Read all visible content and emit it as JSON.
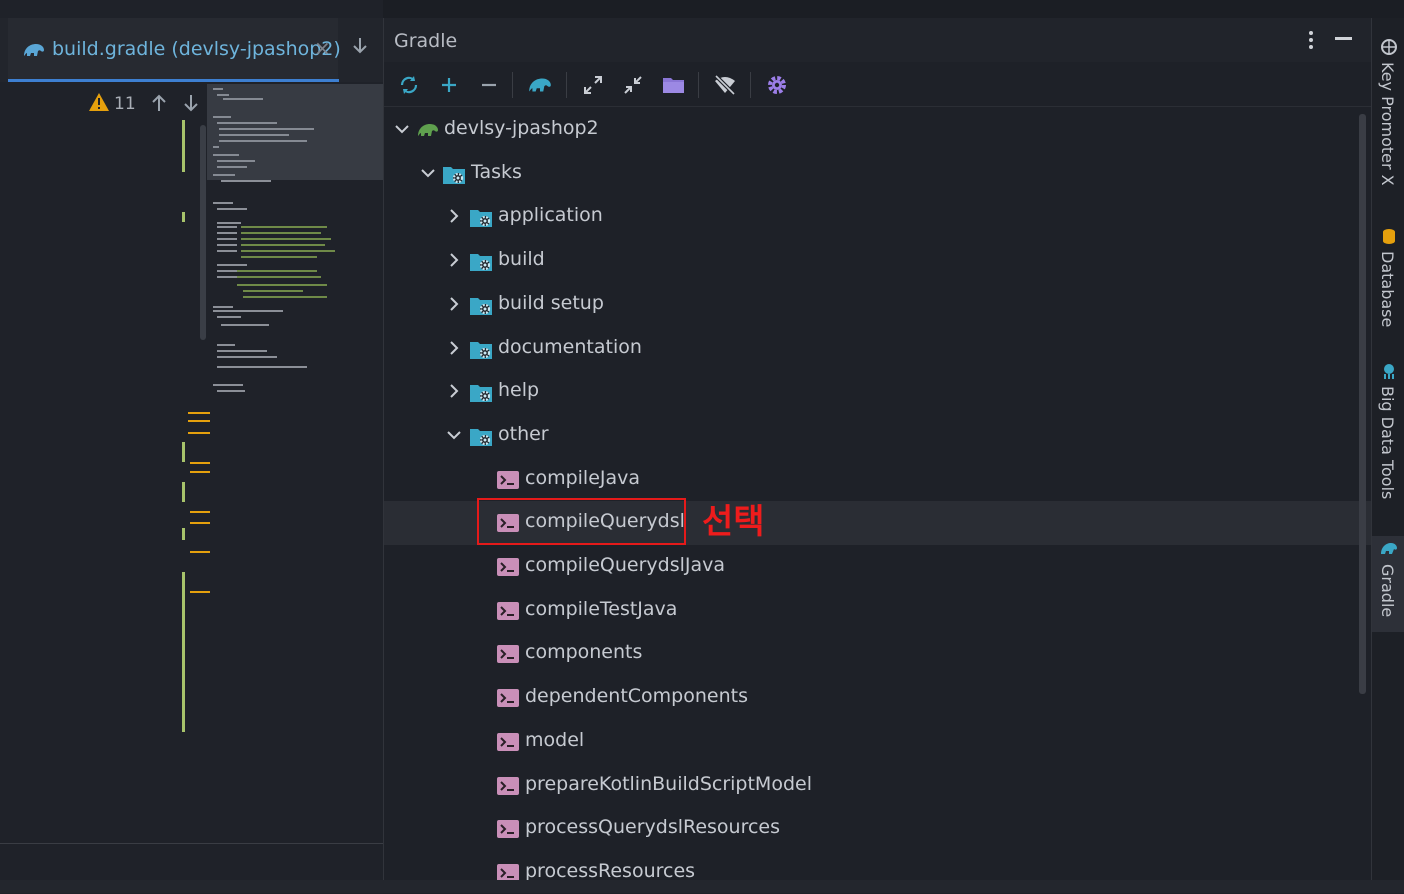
{
  "editor": {
    "tab": {
      "label": "build.gradle (devlsy-jpashop2)",
      "close": "×"
    },
    "inspection": {
      "warning_count": "11"
    }
  },
  "gradle": {
    "title": "Gradle",
    "toolbar": [
      "reload-icon",
      "add-icon",
      "remove-icon",
      "elephant-icon",
      "expand-all-icon",
      "collapse-all-icon",
      "folder-icon",
      "offline-mode-icon",
      "settings-icon"
    ],
    "tree": {
      "project": "devlsy-jpashop2",
      "tasks_label": "Tasks",
      "groups": [
        "application",
        "build",
        "build setup",
        "documentation",
        "help",
        "other"
      ],
      "other_tasks": [
        "compileJava",
        "compileQuerydsl",
        "compileQuerydslJava",
        "compileTestJava",
        "components",
        "dependentComponents",
        "model",
        "prepareKotlinBuildScriptModel",
        "processQuerydslResources",
        "processResources"
      ],
      "selected_task": "compileQuerydsl"
    },
    "annotation": "선택"
  },
  "stripe": {
    "items": [
      "Key Promoter X",
      "Database",
      "Big Data Tools",
      "Gradle"
    ],
    "active": "Gradle"
  },
  "colors": {
    "accent": "#3d7fd1",
    "annotation_red": "#e51a1a",
    "warning": "#e5a00d",
    "gradle_green": "#5fa04e"
  }
}
